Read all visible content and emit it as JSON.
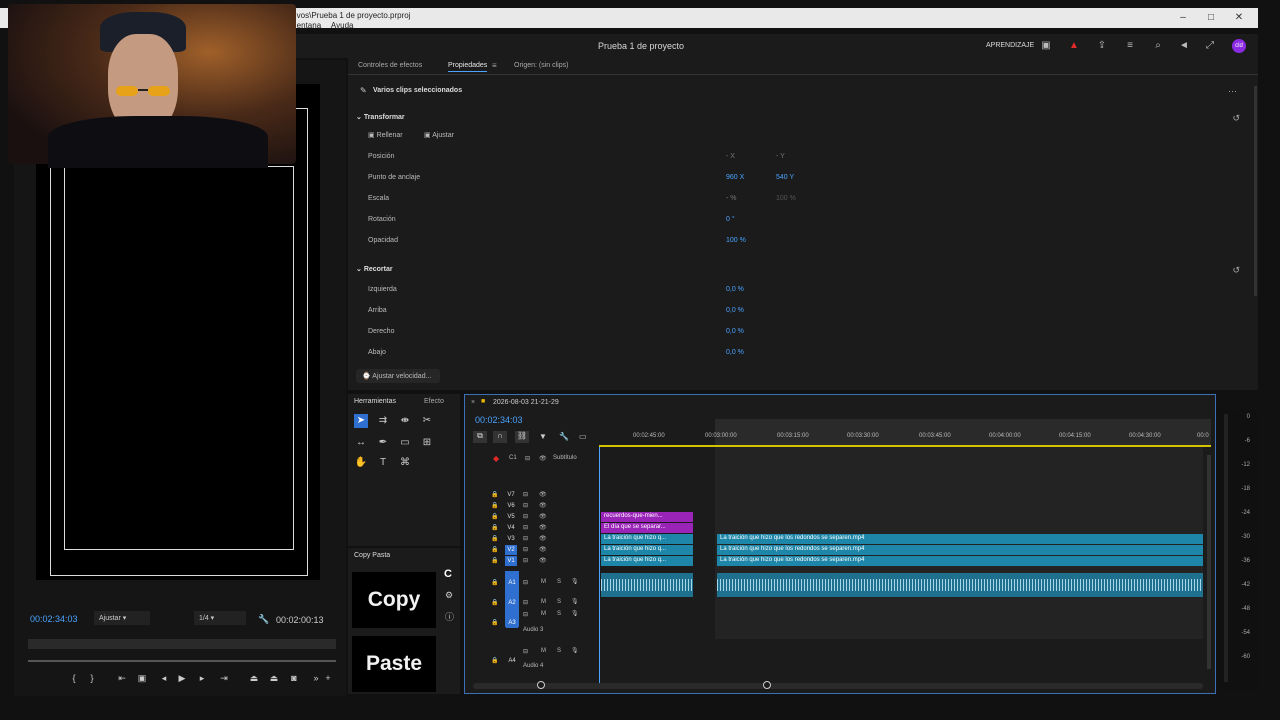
{
  "window": {
    "path": "...vos\\Prueba 1 de proyecto.prproj",
    "menu": [
      "...entana",
      "Ayuda"
    ],
    "controls": [
      "–",
      "□",
      "✕"
    ]
  },
  "header": {
    "title": "Prueba 1 de proyecto",
    "learn": "APRENDIZAJE",
    "avatar": "cld"
  },
  "props_panel": {
    "tabs": [
      "Controles de efectos",
      "Propiedades",
      "Origen: (sin clips)"
    ],
    "heading": "Varios clips seleccionados",
    "transform": {
      "label": "Transformar",
      "fill": "Rellenar",
      "fit": "Ajustar",
      "rows": [
        {
          "label": "Posición",
          "v1": "- X",
          "v2": "- Y"
        },
        {
          "label": "Punto de anclaje",
          "v1": "960 X",
          "v2": "540 Y"
        },
        {
          "label": "Escala",
          "v1": "- %",
          "v2": "100 %"
        },
        {
          "label": "Rotación",
          "v1": "0 °",
          "v2": ""
        },
        {
          "label": "Opacidad",
          "v1": "100 %",
          "v2": ""
        }
      ]
    },
    "crop": {
      "label": "Recortar",
      "rows": [
        {
          "label": "Izquierda",
          "v": "0,0 %"
        },
        {
          "label": "Arriba",
          "v": "0,0 %"
        },
        {
          "label": "Derecho",
          "v": "0,0 %"
        },
        {
          "label": "Abajo",
          "v": "0,0 %"
        }
      ]
    },
    "speed_button": "Ajustar velocidad..."
  },
  "program": {
    "timecode": "00:02:34:03",
    "fit": "Ajustar",
    "quality": "1/4",
    "duration": "00:02:00:13"
  },
  "tools": {
    "tabs": [
      "Herramientas",
      "Efecto"
    ]
  },
  "copypaste": {
    "title": "Copy Pasta",
    "copy": "Copy",
    "paste": "Paste",
    "side_c": "C"
  },
  "timeline": {
    "sequence": "2026-08-03 21-21-29",
    "timecode": "00:02:34:03",
    "ticks": [
      "00:02:45:00",
      "00:03:00:00",
      "00:03:15:00",
      "00:03:30:00",
      "00:03:45:00",
      "00:04:00:00",
      "00:04:15:00",
      "00:04:30:00",
      "00:0"
    ],
    "subtitle_label": "Subtítulo",
    "c1": "C1",
    "video_tracks": [
      "V7",
      "V6",
      "V5",
      "V4",
      "V3",
      "V2",
      "V1"
    ],
    "audio_tracks": [
      "A1",
      "A2",
      "A3",
      "A4"
    ],
    "audio3_name": "Audio 3",
    "audio4_name": "Audio 4",
    "clips": {
      "v5": "recuerdos-que-mien...",
      "v4": "El día que se separar...",
      "short": "La traición que hizo q...",
      "long": "La traición que hizo que los redondos se separen.mp4"
    }
  },
  "meter": {
    "labels": [
      "0",
      "-6",
      "-12",
      "-18",
      "-24",
      "-30",
      "-36",
      "-42",
      "-48",
      "-54",
      "-60"
    ]
  },
  "colors": {
    "accent": "#4aa3ff",
    "purple_clip": "#9a23b8",
    "teal_clip": "#1e86a8"
  }
}
